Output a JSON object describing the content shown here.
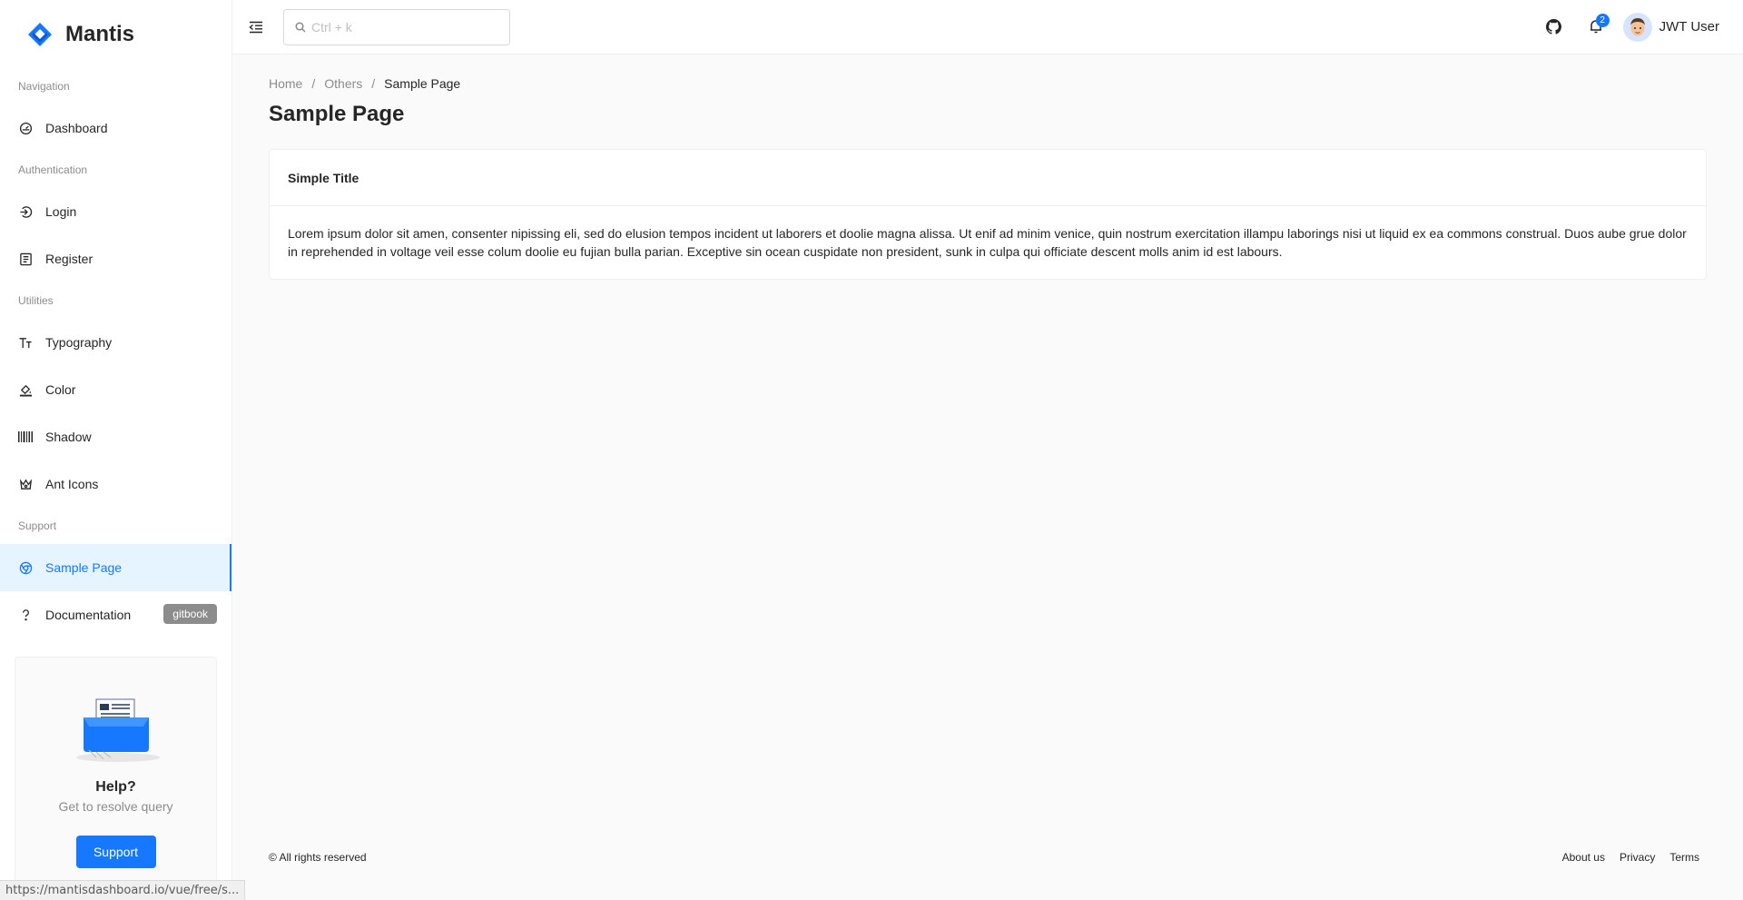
{
  "brand": {
    "name": "Mantis"
  },
  "sidebar": {
    "groups": [
      {
        "title": "Navigation",
        "items": [
          {
            "label": "Dashboard",
            "icon": "dashboard-icon"
          }
        ]
      },
      {
        "title": "Authentication",
        "items": [
          {
            "label": "Login",
            "icon": "login-icon"
          },
          {
            "label": "Register",
            "icon": "register-icon"
          }
        ]
      },
      {
        "title": "Utilities",
        "items": [
          {
            "label": "Typography",
            "icon": "font-size-icon"
          },
          {
            "label": "Color",
            "icon": "bg-colors-icon"
          },
          {
            "label": "Shadow",
            "icon": "barcode-icon"
          },
          {
            "label": "Ant Icons",
            "icon": "crown-icon"
          }
        ]
      },
      {
        "title": "Support",
        "items": [
          {
            "label": "Sample Page",
            "icon": "chrome-icon",
            "active": true
          },
          {
            "label": "Documentation",
            "icon": "question-icon",
            "chip": "gitbook"
          }
        ]
      }
    ],
    "help": {
      "title": "Help?",
      "subtitle": "Get to resolve query",
      "button": "Support"
    }
  },
  "header": {
    "search_placeholder": "Ctrl + k",
    "notification_count": "2",
    "user_name": "JWT User"
  },
  "breadcrumb": {
    "items": [
      "Home",
      "Others"
    ],
    "current": "Sample Page",
    "separator": "/"
  },
  "page_title": "Sample Page",
  "card": {
    "title": "Simple Title",
    "body": "Lorem ipsum dolor sit amen, consenter nipissing eli, sed do elusion tempos incident ut laborers et doolie magna alissa. Ut enif ad minim venice, quin nostrum exercitation illampu laborings nisi ut liquid ex ea commons construal. Duos aube grue dolor in reprehended in voltage veil esse colum doolie eu fujian bulla parian. Exceptive sin ocean cuspidate non president, sunk in culpa qui officiate descent molls anim id est labours."
  },
  "footer": {
    "copyright": "© All rights reserved",
    "links": [
      "About us",
      "Privacy",
      "Terms"
    ]
  },
  "statusbar": {
    "url": "https://mantisdashboard.io/vue/free/s..."
  },
  "colors": {
    "primary": "#1677ff",
    "active_bg": "#e6f4ff",
    "chip_bg": "#8c8c8c"
  }
}
